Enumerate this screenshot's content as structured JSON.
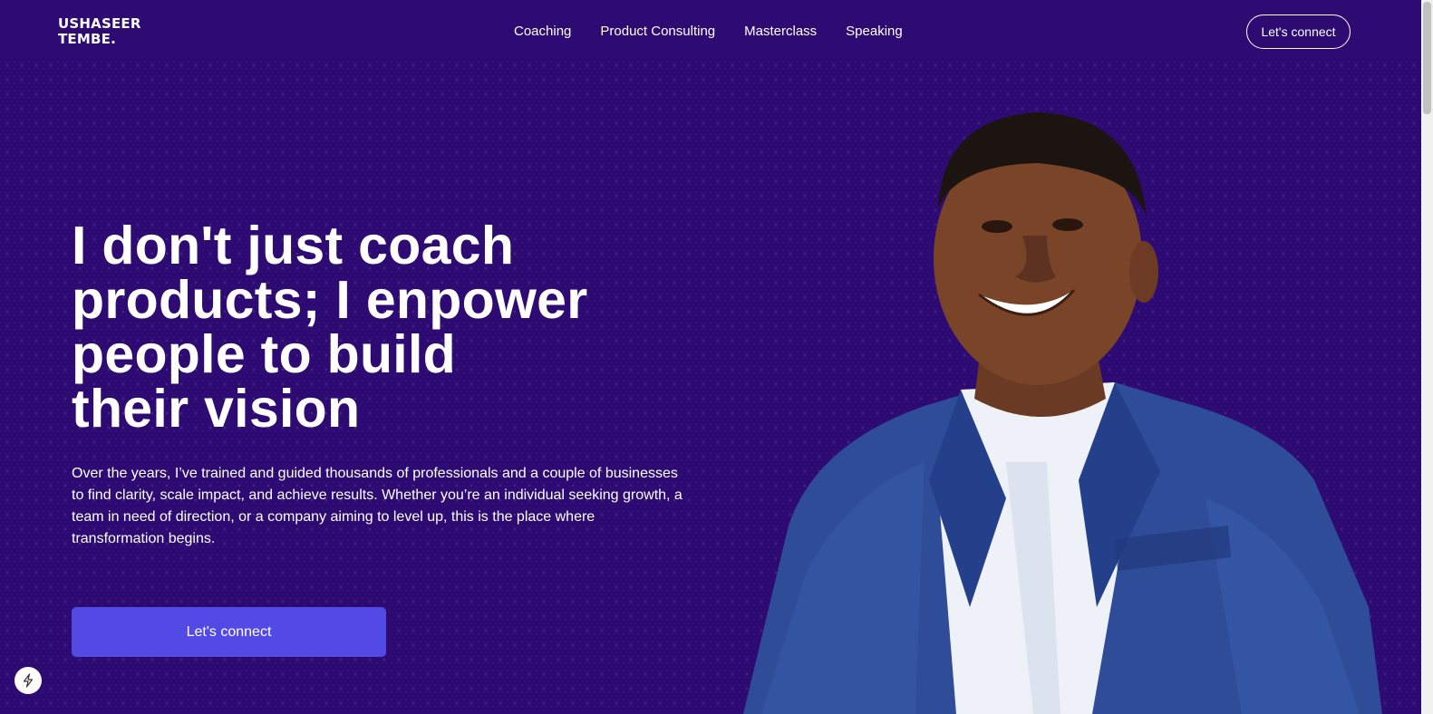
{
  "header": {
    "logo_line1": "USHASEER",
    "logo_line2": "TEMBE.",
    "nav": [
      {
        "label": "Coaching"
      },
      {
        "label": "Product Consulting"
      },
      {
        "label": "Masterclass"
      },
      {
        "label": "Speaking"
      }
    ],
    "cta_label": "Let's connect"
  },
  "hero": {
    "headline_lines": [
      "I don't just coach",
      "products; I enpower",
      "people to build",
      "their vision"
    ],
    "description": "Over the years, I’ve trained and guided thousands of professionals and a couple of businesses to find clarity, scale impact, and achieve results. Whether you’re an individual seeking growth, a team in need of direction, or a company aiming to level up, this is the place where transformation begins.",
    "cta_label": "Let's connect"
  },
  "colors": {
    "background": "#2d0b72",
    "cta_button": "#5349e5",
    "text": "#ffffff"
  },
  "icons": {
    "floating_badge": "lightning-bolt-icon"
  }
}
